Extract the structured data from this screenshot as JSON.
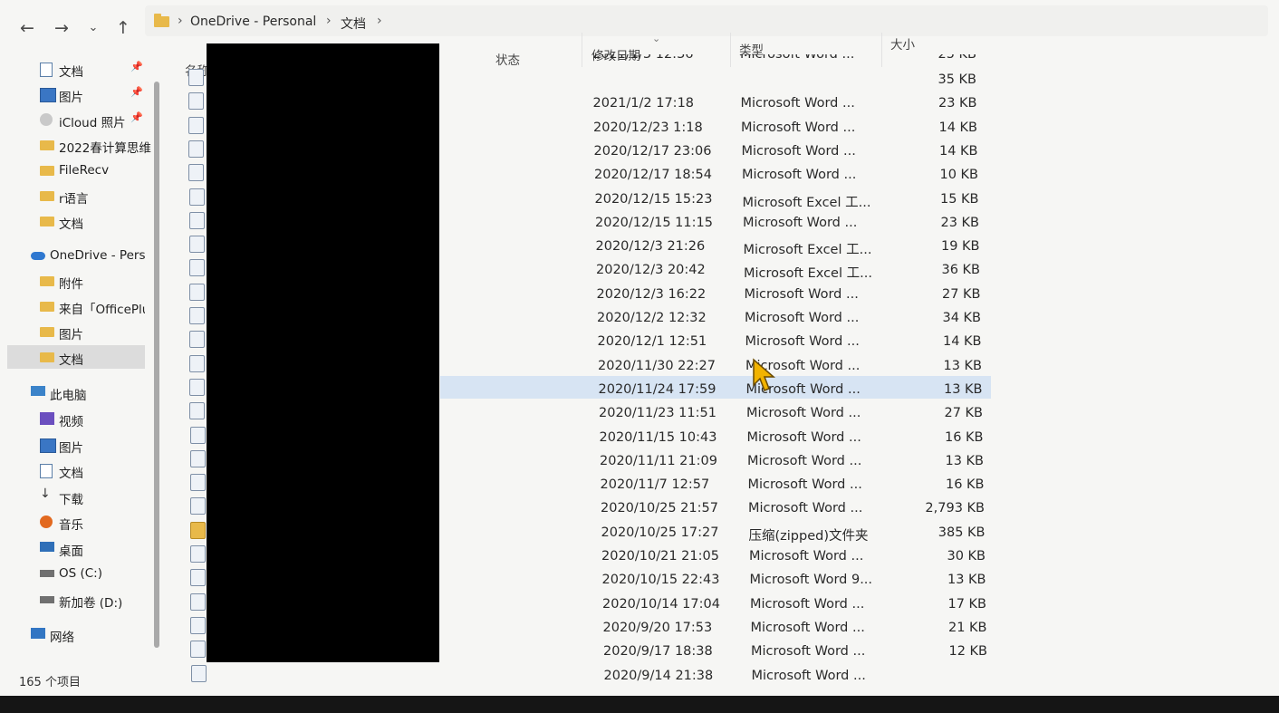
{
  "nav": {
    "back": "←",
    "forward": "→",
    "recent": "⌄",
    "up": "↑",
    "breadcrumb": [
      "OneDrive - Personal",
      "文档"
    ],
    "separator": "›"
  },
  "sidebar": {
    "pin": "📌",
    "quick_access": [
      {
        "label": "文档",
        "icon": "documents-icon",
        "pinned": true
      },
      {
        "label": "图片",
        "icon": "pictures-icon",
        "pinned": true
      },
      {
        "label": "iCloud 照片",
        "icon": "icloud-photos-icon",
        "pinned": true
      },
      {
        "label": "2022春计算思维",
        "icon": "folder-icon",
        "pinned": false
      },
      {
        "label": "FileRecv",
        "icon": "folder-icon",
        "pinned": false
      },
      {
        "label": "r语言",
        "icon": "folder-icon",
        "pinned": false
      },
      {
        "label": "文档",
        "icon": "folder-icon",
        "pinned": false
      }
    ],
    "onedrive": {
      "label": "OneDrive - Personal",
      "icon": "onedrive-icon"
    },
    "onedrive_items": [
      {
        "label": "附件",
        "icon": "folder-icon"
      },
      {
        "label": "来自「OfficePlus」",
        "icon": "folder-icon"
      },
      {
        "label": "图片",
        "icon": "folder-icon"
      },
      {
        "label": "文档",
        "icon": "folder-icon",
        "selected": true
      }
    ],
    "this_pc": {
      "label": "此电脑",
      "icon": "this-pc-icon"
    },
    "pc_items": [
      {
        "label": "视频",
        "icon": "videos-icon"
      },
      {
        "label": "图片",
        "icon": "pictures-icon"
      },
      {
        "label": "文档",
        "icon": "documents-icon"
      },
      {
        "label": "下载",
        "icon": "downloads-icon"
      },
      {
        "label": "音乐",
        "icon": "music-icon"
      },
      {
        "label": "桌面",
        "icon": "desktop-icon"
      },
      {
        "label": "OS (C:)",
        "icon": "drive-icon"
      },
      {
        "label": "新加卷 (D:)",
        "icon": "drive-icon"
      }
    ],
    "network": {
      "label": "网络",
      "icon": "network-icon"
    }
  },
  "columns": {
    "name": "名称",
    "status": "状态",
    "modified": "修改日期",
    "type": "类型",
    "size": "大小"
  },
  "partial_row": {
    "date": "2021/1/3 12:36",
    "type": "Microsoft Word ...",
    "size": "25 KB"
  },
  "files": [
    {
      "date": "",
      "type": "",
      "size": "35 KB"
    },
    {
      "date": "2021/1/2 17:18",
      "type": "Microsoft Word ...",
      "size": "23 KB"
    },
    {
      "date": "2020/12/23 1:18",
      "type": "Microsoft Word ...",
      "size": "14 KB"
    },
    {
      "date": "2020/12/17 23:06",
      "type": "Microsoft Word ...",
      "size": "14 KB"
    },
    {
      "date": "2020/12/17 18:54",
      "type": "Microsoft Word ...",
      "size": "10 KB"
    },
    {
      "date": "2020/12/15 15:23",
      "type": "Microsoft Excel 工...",
      "size": "15 KB"
    },
    {
      "date": "2020/12/15 11:15",
      "type": "Microsoft Word ...",
      "size": "23 KB"
    },
    {
      "date": "2020/12/3 21:26",
      "type": "Microsoft Excel 工...",
      "size": "19 KB"
    },
    {
      "date": "2020/12/3 20:42",
      "type": "Microsoft Excel 工...",
      "size": "36 KB"
    },
    {
      "date": "2020/12/3 16:22",
      "type": "Microsoft Word ...",
      "size": "27 KB"
    },
    {
      "date": "2020/12/2 12:32",
      "type": "Microsoft Word ...",
      "size": "34 KB"
    },
    {
      "date": "2020/12/1 12:51",
      "type": "Microsoft Word ...",
      "size": "14 KB"
    },
    {
      "date": "2020/11/30 22:27",
      "type": "Microsoft Word ...",
      "size": "13 KB"
    },
    {
      "date": "2020/11/24 17:59",
      "type": "Microsoft Word ...",
      "size": "13 KB",
      "selected": true
    },
    {
      "date": "2020/11/23 11:51",
      "type": "Microsoft Word ...",
      "size": "27 KB"
    },
    {
      "date": "2020/11/15 10:43",
      "type": "Microsoft Word ...",
      "size": "16 KB"
    },
    {
      "date": "2020/11/11 21:09",
      "type": "Microsoft Word ...",
      "size": "13 KB"
    },
    {
      "date": "2020/11/7 12:57",
      "type": "Microsoft Word ...",
      "size": "16 KB"
    },
    {
      "date": "2020/10/25 21:57",
      "type": "Microsoft Word ...",
      "size": "2,793 KB"
    },
    {
      "date": "2020/10/25 17:27",
      "type": "压缩(zipped)文件夹",
      "size": "385 KB",
      "zip": true
    },
    {
      "date": "2020/10/21 21:05",
      "type": "Microsoft Word ...",
      "size": "30 KB"
    },
    {
      "date": "2020/10/15 22:43",
      "type": "Microsoft Word 9...",
      "size": "13 KB"
    },
    {
      "date": "2020/10/14 17:04",
      "type": "Microsoft Word ...",
      "size": "17 KB"
    },
    {
      "date": "2020/9/20 17:53",
      "type": "Microsoft Word ...",
      "size": "21 KB"
    },
    {
      "date": "2020/9/17 18:38",
      "type": "Microsoft Word ...",
      "size": "12 KB"
    },
    {
      "date": "2020/9/14 21:38",
      "type": "Microsoft Word ...",
      "size": ""
    }
  ],
  "status": {
    "item_count": "165 个项目"
  },
  "colors": {
    "selection": "#d7e4f3",
    "folder": "#e8b94a",
    "cursor": "#f2b300"
  }
}
